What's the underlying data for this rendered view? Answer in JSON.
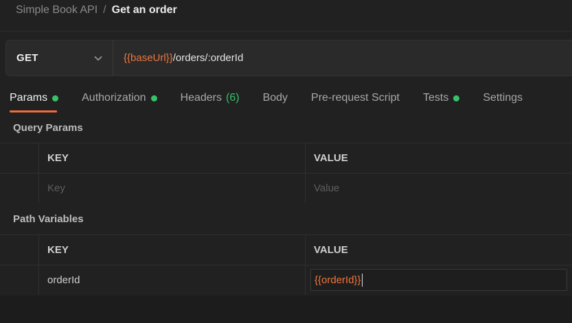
{
  "breadcrumb": {
    "collection": "Simple Book API",
    "separator": "/",
    "request": "Get an order"
  },
  "request": {
    "method": "GET",
    "url_variable": "{{baseUrl}}",
    "url_path": "/orders/:orderId"
  },
  "tabs": [
    {
      "label": "Params",
      "active": true,
      "dot": true
    },
    {
      "label": "Authorization",
      "dot": true
    },
    {
      "label": "Headers",
      "count": "(6)"
    },
    {
      "label": "Body"
    },
    {
      "label": "Pre-request Script"
    },
    {
      "label": "Tests",
      "dot": true
    },
    {
      "label": "Settings"
    }
  ],
  "query_params": {
    "title": "Query Params",
    "columns": {
      "key": "KEY",
      "value": "VALUE"
    },
    "placeholders": {
      "key": "Key",
      "value": "Value"
    }
  },
  "path_variables": {
    "title": "Path Variables",
    "columns": {
      "key": "KEY",
      "value": "VALUE"
    },
    "rows": [
      {
        "key": "orderId",
        "value": "{{orderId}}"
      }
    ]
  },
  "colors": {
    "accent": "#f26b3a",
    "variable": "#f0763d",
    "status_dot": "#37c26a"
  }
}
